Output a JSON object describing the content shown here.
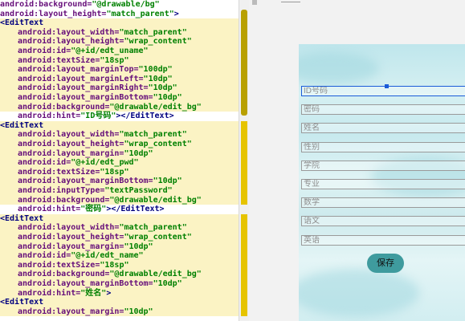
{
  "editor": {
    "lines": [
      {
        "indent": 0,
        "tag": "",
        "attr": "android:background=",
        "val": "\"@drawable/bg\"",
        "end": "",
        "hl": false
      },
      {
        "indent": 0,
        "tag": "",
        "attr": "android:layout_height=",
        "val": "\"match_parent\"",
        "end": ">",
        "hl": false
      },
      {
        "indent": 0,
        "tag": "<EditText",
        "attr": "",
        "val": "",
        "end": "",
        "hl": true
      },
      {
        "indent": 1,
        "tag": "",
        "attr": "android:layout_width=",
        "val": "\"match_parent\"",
        "end": "",
        "hl": true
      },
      {
        "indent": 1,
        "tag": "",
        "attr": "android:layout_height=",
        "val": "\"wrap_content\"",
        "end": "",
        "hl": true
      },
      {
        "indent": 1,
        "tag": "",
        "attr": "android:id=",
        "val": "\"@+id/edt_uname\"",
        "end": "",
        "hl": true
      },
      {
        "indent": 1,
        "tag": "",
        "attr": "android:textSize=",
        "val": "\"18sp\"",
        "end": "",
        "hl": true
      },
      {
        "indent": 1,
        "tag": "",
        "attr": "android:layout_marginTop=",
        "val": "\"100dp\"",
        "end": "",
        "hl": true
      },
      {
        "indent": 1,
        "tag": "",
        "attr": "android:layout_marginLeft=",
        "val": "\"10dp\"",
        "end": "",
        "hl": true
      },
      {
        "indent": 1,
        "tag": "",
        "attr": "android:layout_marginRight=",
        "val": "\"10dp\"",
        "end": "",
        "hl": true
      },
      {
        "indent": 1,
        "tag": "",
        "attr": "android:layout_marginBottom=",
        "val": "\"10dp\"",
        "end": "",
        "hl": true
      },
      {
        "indent": 1,
        "tag": "",
        "attr": "android:background=",
        "val": "\"@drawable/edit_bg\"",
        "end": "",
        "hl": true
      },
      {
        "indent": 1,
        "tag": "",
        "attr": "android:hint=",
        "val": "\"ID号码\"",
        "end": "></EditText>",
        "hl": false
      },
      {
        "indent": 0,
        "tag": "<EditText",
        "attr": "",
        "val": "",
        "end": "",
        "hl": true
      },
      {
        "indent": 1,
        "tag": "",
        "attr": "android:layout_width=",
        "val": "\"match_parent\"",
        "end": "",
        "hl": true
      },
      {
        "indent": 1,
        "tag": "",
        "attr": "android:layout_height=",
        "val": "\"wrap_content\"",
        "end": "",
        "hl": true
      },
      {
        "indent": 1,
        "tag": "",
        "attr": "android:layout_margin=",
        "val": "\"10dp\"",
        "end": "",
        "hl": true
      },
      {
        "indent": 1,
        "tag": "",
        "attr": "android:id=",
        "val": "\"@+id/edt_pwd\"",
        "end": "",
        "hl": true
      },
      {
        "indent": 1,
        "tag": "",
        "attr": "android:textSize=",
        "val": "\"18sp\"",
        "end": "",
        "hl": true
      },
      {
        "indent": 1,
        "tag": "",
        "attr": "android:layout_marginBottom=",
        "val": "\"10dp\"",
        "end": "",
        "hl": true
      },
      {
        "indent": 1,
        "tag": "",
        "attr": "android:inputType=",
        "val": "\"textPassword\"",
        "end": "",
        "hl": true
      },
      {
        "indent": 1,
        "tag": "",
        "attr": "android:background=",
        "val": "\"@drawable/edit_bg\"",
        "end": "",
        "hl": true
      },
      {
        "indent": 1,
        "tag": "",
        "attr": "android:hint=",
        "val": "\"密码\"",
        "end": "></EditText>",
        "hl": false
      },
      {
        "indent": 0,
        "tag": "<EditText",
        "attr": "",
        "val": "",
        "end": "",
        "hl": true
      },
      {
        "indent": 1,
        "tag": "",
        "attr": "android:layout_width=",
        "val": "\"match_parent\"",
        "end": "",
        "hl": true
      },
      {
        "indent": 1,
        "tag": "",
        "attr": "android:layout_height=",
        "val": "\"wrap_content\"",
        "end": "",
        "hl": true
      },
      {
        "indent": 1,
        "tag": "",
        "attr": "android:layout_margin=",
        "val": "\"10dp\"",
        "end": "",
        "hl": true
      },
      {
        "indent": 1,
        "tag": "",
        "attr": "android:id=",
        "val": "\"@+id/edt_name\"",
        "end": "",
        "hl": true
      },
      {
        "indent": 1,
        "tag": "",
        "attr": "android:textSize=",
        "val": "\"18sp\"",
        "end": "",
        "hl": true
      },
      {
        "indent": 1,
        "tag": "",
        "attr": "android:background=",
        "val": "\"@drawable/edit_bg\"",
        "end": "",
        "hl": true
      },
      {
        "indent": 1,
        "tag": "",
        "attr": "android:layout_marginBottom=",
        "val": "\"10dp\"",
        "end": "",
        "hl": true
      },
      {
        "indent": 1,
        "tag": "",
        "attr": "android:hint=",
        "val": "\"姓名\"",
        "end": ">",
        "hl": true
      },
      {
        "indent": 0,
        "tag": "<EditText",
        "attr": "",
        "val": "",
        "end": "",
        "hl": true
      },
      {
        "indent": 1,
        "tag": "",
        "attr": "android:layout_margin=",
        "val": "\"10dp\"",
        "end": "",
        "hl": true
      }
    ]
  },
  "preview": {
    "fields": [
      {
        "hint": "ID号码",
        "selected": true
      },
      {
        "hint": "密码",
        "selected": false
      },
      {
        "hint": "姓名",
        "selected": false
      },
      {
        "hint": "性别",
        "selected": false
      },
      {
        "hint": "学院",
        "selected": false
      },
      {
        "hint": "专业",
        "selected": false
      },
      {
        "hint": "数学",
        "selected": false
      },
      {
        "hint": "语文",
        "selected": false
      },
      {
        "hint": "英语",
        "selected": false
      }
    ],
    "save_label": "保存"
  },
  "colors": {
    "editor_highlight": "#fbf3c4",
    "gutter_marker": "#e6c400",
    "selection": "#1a5bd8",
    "save_button": "#3f9b9e"
  }
}
